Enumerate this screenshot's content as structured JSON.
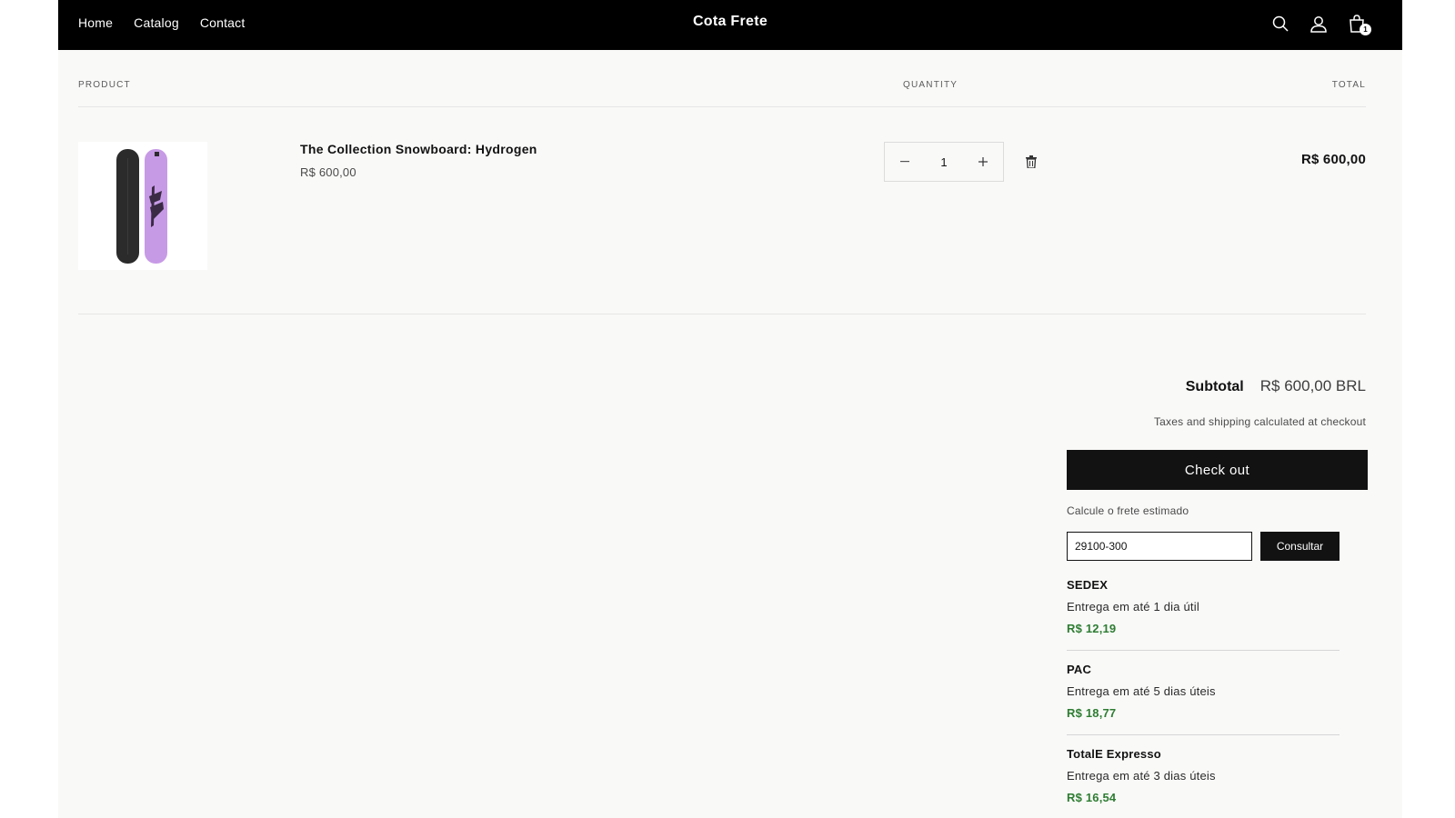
{
  "header": {
    "nav": [
      "Home",
      "Catalog",
      "Contact"
    ],
    "brand": "Cota Frete",
    "cart_count": "1",
    "icons": [
      "search-icon",
      "account-icon",
      "cart-icon"
    ]
  },
  "table": {
    "product_heading": "PRODUCT",
    "quantity_heading": "QUANTITY",
    "total_heading": "TOTAL"
  },
  "item": {
    "title": "The Collection Snowboard: Hydrogen",
    "price": "R$ 600,00",
    "quantity": "1",
    "total": "R$ 600,00",
    "image_colors": {
      "board_dark": "#2b2b2b",
      "board_purple": "#c79ae6"
    }
  },
  "summary": {
    "subtotal_label": "Subtotal",
    "subtotal_value": "R$ 600,00 BRL",
    "tax_note": "Taxes and shipping calculated at checkout",
    "checkout_label": "Check out"
  },
  "freight": {
    "label": "Calcule o frete estimado",
    "cep_value": "29100-300",
    "button_label": "Consultar",
    "options": [
      {
        "name": "SEDEX",
        "eta": "Entrega em até 1 dia útil",
        "price": "R$ 12,19"
      },
      {
        "name": "PAC",
        "eta": "Entrega em até 5 dias úteis",
        "price": "R$ 18,77"
      },
      {
        "name": "TotalE Expresso",
        "eta": "Entrega em até 3 dias úteis",
        "price": "R$ 16,54"
      }
    ]
  },
  "colors": {
    "accent_green": "#2e7d32",
    "header_bg": "#000000",
    "page_bg": "#f9f9f8"
  }
}
